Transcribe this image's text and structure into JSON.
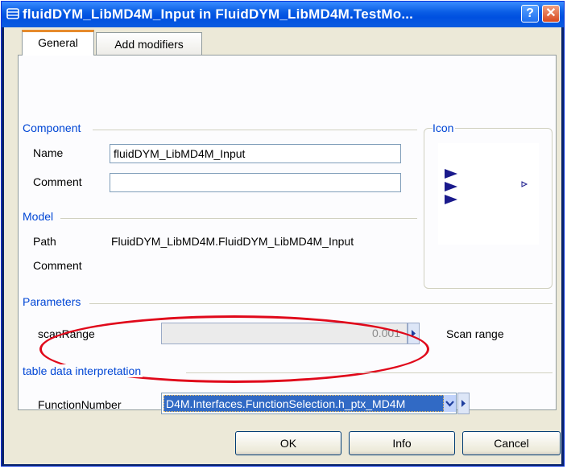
{
  "window": {
    "title": "fluidDYM_LibMD4M_Input in FluidDYM_LibMD4M.TestMo...",
    "help_label": "?",
    "close_label": "✕"
  },
  "tabs": [
    {
      "label": "General",
      "active": true
    },
    {
      "label": "Add modifiers",
      "active": false
    }
  ],
  "component": {
    "group_label": "Component",
    "name_label": "Name",
    "name_value": "fluidDYM_LibMD4M_Input",
    "comment_label": "Comment",
    "comment_value": ""
  },
  "icon_group": {
    "label": "Icon"
  },
  "model": {
    "group_label": "Model",
    "path_label": "Path",
    "path_value": "FluidDYM_LibMD4M.FluidDYM_LibMD4M_Input",
    "comment_label": "Comment"
  },
  "parameters": {
    "group_label": "Parameters",
    "scan_label": "scanRange",
    "scan_value": "0.001",
    "scan_description": "Scan range"
  },
  "table_data": {
    "group_label": "table data interpretation",
    "function_label": "FunctionNumber",
    "function_value": "D4M.Interfaces.FunctionSelection.h_ptx_MD4M"
  },
  "buttons": {
    "ok": "OK",
    "info": "Info",
    "cancel": "Cancel"
  },
  "colors": {
    "titlebar": "#0a5ee6",
    "group_label": "#0046d5",
    "selection": "#316ac5",
    "annotation_oval": "#e0081a"
  }
}
